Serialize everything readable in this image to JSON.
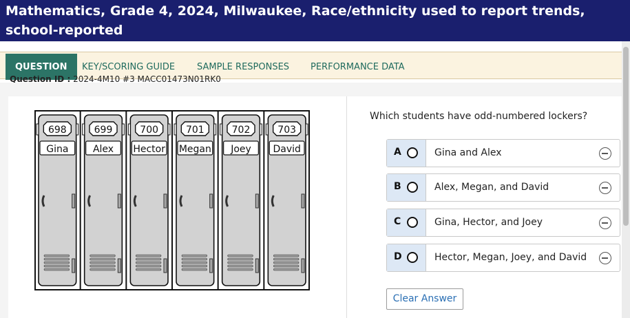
{
  "header": {
    "title": "Mathematics, Grade 4, 2024, Milwaukee, Race/ethnicity used to report trends, school-reported"
  },
  "tabs": [
    {
      "label": "QUESTION",
      "active": true
    },
    {
      "label": "KEY/SCORING GUIDE",
      "active": false
    },
    {
      "label": "SAMPLE RESPONSES",
      "active": false
    },
    {
      "label": "PERFORMANCE DATA",
      "active": false
    }
  ],
  "question_id": {
    "label": "Question ID :",
    "value": "2024-4M10 #3 MACC01473N01RK0"
  },
  "lockers": [
    {
      "number": "698",
      "name": "Gina"
    },
    {
      "number": "699",
      "name": "Alex"
    },
    {
      "number": "700",
      "name": "Hector"
    },
    {
      "number": "701",
      "name": "Megan"
    },
    {
      "number": "702",
      "name": "Joey"
    },
    {
      "number": "703",
      "name": "David"
    }
  ],
  "question": {
    "prompt": "Which students have odd-numbered lockers?",
    "options": [
      {
        "letter": "A",
        "text": "Gina and Alex"
      },
      {
        "letter": "B",
        "text": "Alex, Megan, and David"
      },
      {
        "letter": "C",
        "text": "Gina, Hector, and Joey"
      },
      {
        "letter": "D",
        "text": "Hector, Megan, Joey, and David"
      }
    ],
    "clear_label": "Clear Answer"
  },
  "icons": {
    "radio": "radio-button-icon",
    "eliminate": "minus-circle-icon"
  },
  "colors": {
    "header_bg": "#1a1f6e",
    "tab_active_bg": "#2c7466",
    "tab_text": "#1f6b5e",
    "tabbar_bg": "#fbf3e0",
    "option_letter_bg": "#dde8f5",
    "clear_text": "#2a6fb4"
  }
}
